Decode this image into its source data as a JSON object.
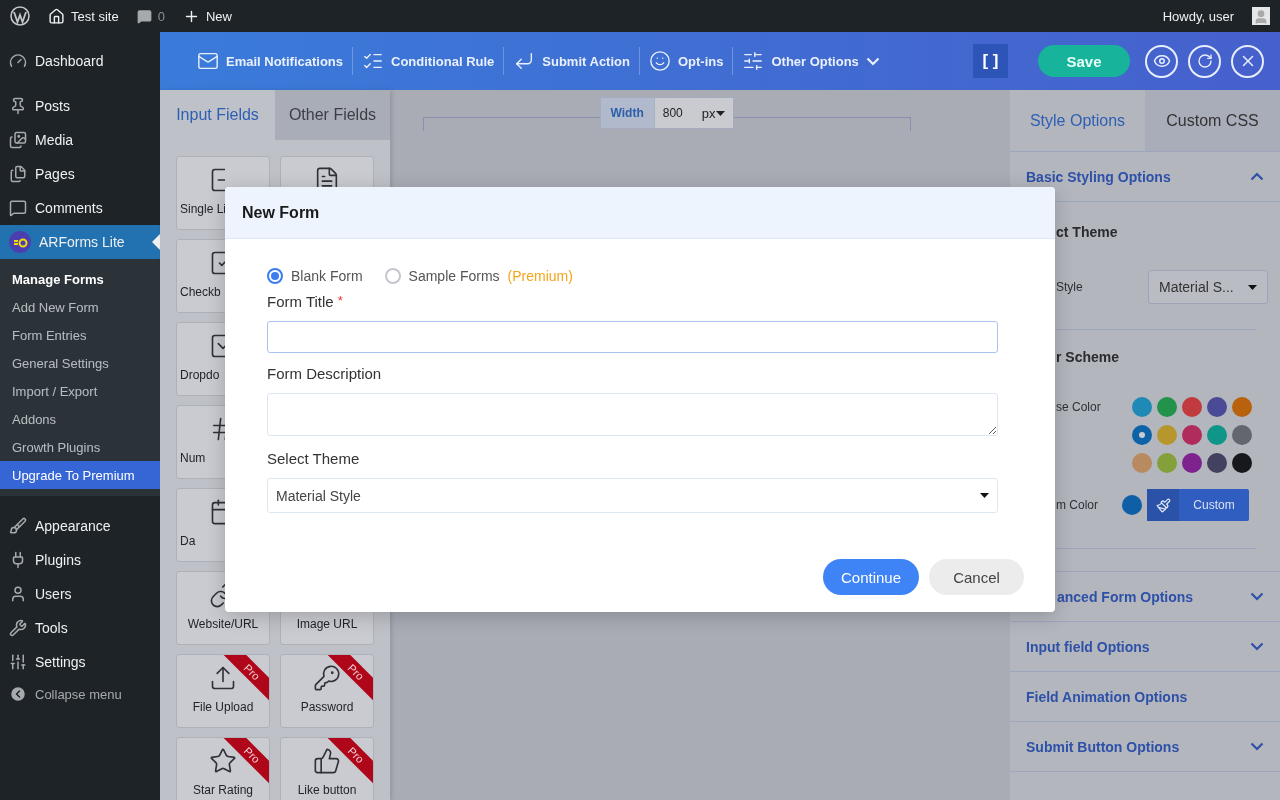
{
  "admin_bar": {
    "site": "Test site",
    "comments": "0",
    "new": "New",
    "greeting": "Howdy, user"
  },
  "sidebar": {
    "items": [
      {
        "label": "Dashboard",
        "selected": false
      },
      {
        "label": "Posts",
        "selected": false
      },
      {
        "label": "Media",
        "selected": false
      },
      {
        "label": "Pages",
        "selected": false
      },
      {
        "label": "Comments",
        "selected": false
      },
      {
        "label": "ARForms Lite",
        "selected": true,
        "children": [
          {
            "label": "Manage Forms",
            "selected": true,
            "highlighted": false
          },
          {
            "label": "Add New Form",
            "selected": false,
            "highlighted": false
          },
          {
            "label": "Form Entries",
            "selected": false,
            "highlighted": false
          },
          {
            "label": "General Settings",
            "selected": false,
            "highlighted": false
          },
          {
            "label": "Import / Export",
            "selected": false,
            "highlighted": false
          },
          {
            "label": "Addons",
            "selected": false,
            "highlighted": false
          },
          {
            "label": "Growth Plugins",
            "selected": false,
            "highlighted": false
          },
          {
            "label": "Upgrade To Premium",
            "selected": false,
            "highlighted": true
          }
        ]
      },
      {
        "label": "Appearance",
        "selected": false
      },
      {
        "label": "Plugins",
        "selected": false
      },
      {
        "label": "Users",
        "selected": false
      },
      {
        "label": "Tools",
        "selected": false
      },
      {
        "label": "Settings",
        "selected": false
      }
    ],
    "collapse": "Collapse menu"
  },
  "toolbar": {
    "items": [
      "Email Notifications",
      "Conditional Rule",
      "Submit Action",
      "Opt-ins",
      "Other Options"
    ],
    "shortcode": "[ ]",
    "save": "Save"
  },
  "left_panel": {
    "tabs": [
      {
        "label": "Input Fields",
        "selected": true
      },
      {
        "label": "Other Fields",
        "selected": false
      }
    ],
    "fields": [
      {
        "kind": "field",
        "label": "Single Li"
      },
      {
        "kind": "field"
      },
      {
        "kind": "field",
        "label": "Checkb"
      },
      {
        "kind": "covered"
      },
      {
        "kind": "field",
        "label": "Dropdo"
      },
      {
        "kind": "covered"
      },
      {
        "kind": "field",
        "label": "Num"
      },
      {
        "kind": "covered"
      },
      {
        "kind": "field",
        "label": "Da"
      },
      {
        "kind": "covered"
      },
      {
        "kind": "field",
        "label": "Website/URL"
      },
      {
        "kind": "field",
        "label": "Image URL"
      },
      {
        "kind": "field",
        "label": "File Upload",
        "badge": "Pro"
      },
      {
        "kind": "field",
        "label": "Password",
        "badge": "Pro"
      },
      {
        "kind": "field",
        "label": "Star Rating",
        "badge": "Pro"
      },
      {
        "kind": "field",
        "label": "Like button",
        "badge": "Pro"
      }
    ]
  },
  "canvas": {
    "width_label": "Width",
    "width_value": "800",
    "unit": "px"
  },
  "right_panel": {
    "tabs": [
      {
        "label": "Style Options",
        "selected": true
      },
      {
        "label": "Custom CSS",
        "selected": false
      }
    ],
    "basic": {
      "title": "Basic Styling Options",
      "expanded": true,
      "theme_heading": "ct Theme",
      "theme_label": "Style",
      "theme_value": "Material S...",
      "scheme_heading": "r Scheme",
      "base_label": "se Color",
      "colors": [
        {
          "color": "#1e8ab5",
          "selected": false
        },
        {
          "color": "#23924a",
          "selected": false
        },
        {
          "color": "#c03a3e",
          "selected": false
        },
        {
          "color": "#4a4a96",
          "selected": false
        },
        {
          "color": "#b8620f",
          "selected": false
        },
        {
          "color": "#0e62a8",
          "selected": true
        },
        {
          "color": "#b8962e",
          "selected": false
        },
        {
          "color": "#b02c5c",
          "selected": false
        },
        {
          "color": "#0f9688",
          "selected": false
        },
        {
          "color": "#63666d",
          "selected": false
        },
        {
          "color": "#b88a60",
          "selected": false
        },
        {
          "color": "#83a03a",
          "selected": false
        },
        {
          "color": "#7e2290",
          "selected": false
        },
        {
          "color": "#424260",
          "selected": false
        },
        {
          "color": "#17181c",
          "selected": false
        }
      ],
      "custom_label": "m Color",
      "custom_swatch": {
        "color": "#0e5fa6"
      },
      "custom_button": "Custom"
    },
    "sections": [
      {
        "title": "anced Form Options",
        "kind": "toggle",
        "expanded": false
      },
      {
        "title": "Input field Options",
        "kind": "toggle",
        "expanded": false
      },
      {
        "title": "Field Animation Options",
        "kind": "plain"
      },
      {
        "title": "Submit Button Options",
        "kind": "toggle",
        "expanded": false
      }
    ]
  },
  "modal": {
    "title": "New Form",
    "options": [
      {
        "label": "Blank Form",
        "selected": true
      },
      {
        "label": "Sample Forms",
        "note": "(Premium)",
        "selected": false
      }
    ],
    "title_label": "Form Title",
    "required": "*",
    "description_label": "Form Description",
    "theme_label": "Select Theme",
    "theme_value": "Material Style",
    "buttons": [
      {
        "label": "Continue",
        "kind": "primary"
      },
      {
        "label": "Cancel",
        "kind": "secondary"
      }
    ]
  }
}
